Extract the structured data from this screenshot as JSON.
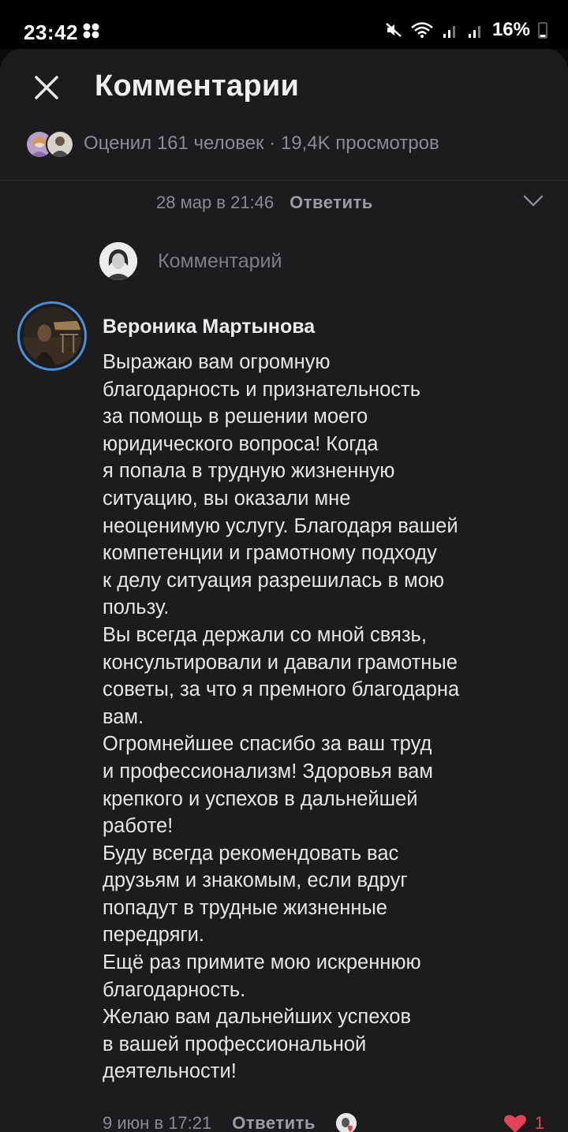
{
  "status_bar": {
    "time": "23:42",
    "battery": "16%",
    "icons": [
      "mute-icon",
      "wifi-icon",
      "signal-icon",
      "signal-icon",
      "battery-icon"
    ]
  },
  "header": {
    "title": "Комментарии",
    "close_icon": "close-icon"
  },
  "stats": {
    "text": "Оценил 161 человек · 19,4K просмотров"
  },
  "previous_comment": {
    "date": "28 мар в 21:46",
    "reply_label": "Ответить"
  },
  "composer": {
    "placeholder": "Комментарий"
  },
  "comment": {
    "author": "Вероника Мартынова",
    "lines": [
      "Выражаю вам огромную",
      "благодарность и признательность",
      "за помощь в решении моего",
      "юридического вопроса! Когда",
      "я попала в трудную жизненную",
      "ситуацию, вы оказали мне",
      "неоценимую услугу. Благодаря вашей",
      "компетенции и грамотному подходу",
      "к делу ситуация разрешилась в мою",
      "пользу.",
      "Вы всегда держали со мной связь,",
      "консультировали и давали грамотные",
      "советы, за что я премного благодарна",
      "вам.",
      "Огромнейшее спасибо за ваш труд",
      "и профессионализм! Здоровья вам",
      "крепкого и успехов в дальнейшей",
      "работе!",
      "Буду всегда рекомендовать вас",
      "друзьям и знакомым, если вдруг",
      "попадут в трудные жизненные",
      "передряги.",
      "Ещё раз примите мою искреннюю",
      "благодарность.",
      "Желаю вам дальнейших успехов",
      "в вашей профессиональной",
      "деятельности!"
    ],
    "date": "9 июн в 17:21",
    "reply_label": "Ответить",
    "likes": "1"
  },
  "colors": {
    "background": "#1c1c1e",
    "accent_like": "#e0435a",
    "avatar_ring": "#4c8ed8",
    "secondary_text": "#8b8b90"
  }
}
